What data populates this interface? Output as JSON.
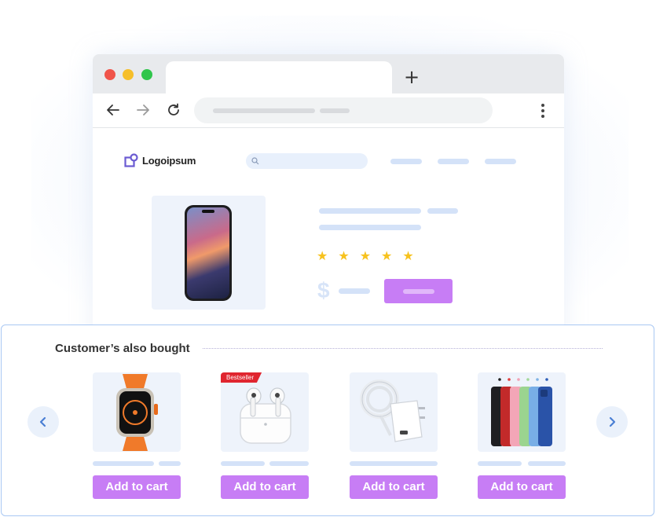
{
  "browser": {
    "new_tab_label": "+",
    "buttons": {
      "back_icon": "arrow-left",
      "forward_icon": "arrow-right",
      "reload_icon": "reload",
      "menu_icon": "kebab"
    }
  },
  "site": {
    "logo_text": "Logoipsum",
    "product": {
      "rating": 5,
      "price_symbol": "$"
    }
  },
  "also_bought": {
    "title": "Customer’s also bought",
    "items": [
      {
        "product": "apple-watch-ultra",
        "badge": "",
        "cart_label": "Add to cart"
      },
      {
        "product": "airpods-pro",
        "badge": "Bestseller",
        "cart_label": "Add to cart"
      },
      {
        "product": "usb-c-charger-cable",
        "badge": "",
        "cart_label": "Add to cart"
      },
      {
        "product": "iphone-cases",
        "badge": "",
        "cart_label": "Add to cart"
      }
    ]
  },
  "colors": {
    "accent": "#c77df5",
    "placeholder": "#d4e2f8",
    "badge": "#e0252f",
    "star": "#f7c21e"
  }
}
